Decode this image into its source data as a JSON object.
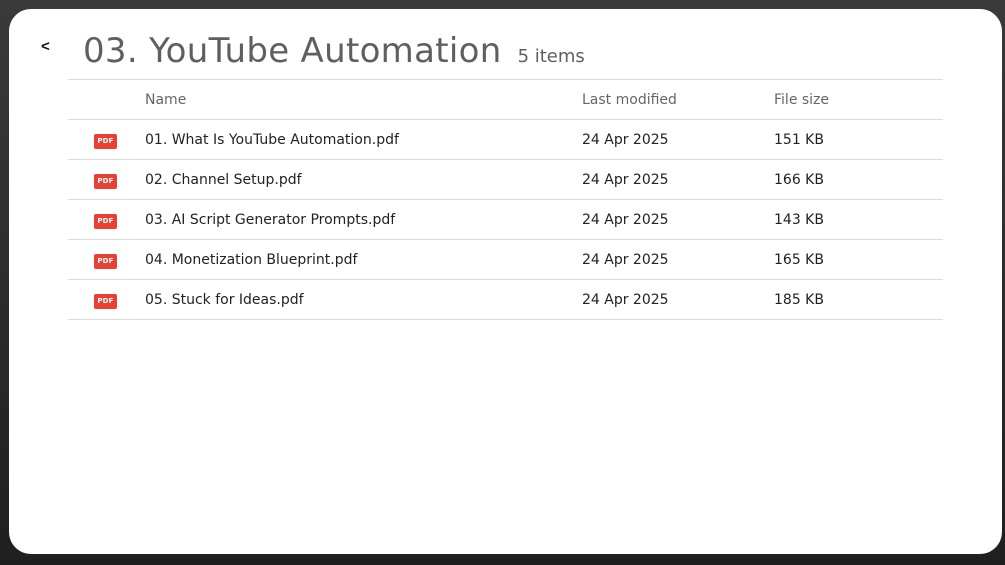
{
  "header": {
    "back_label": "<",
    "title": "03. YouTube Automation",
    "count": "5 items"
  },
  "columns": {
    "name": "Name",
    "modified": "Last modified",
    "size": "File size"
  },
  "file_icon_label": "PDF",
  "files": [
    {
      "name": "01. What Is YouTube Automation.pdf",
      "modified": "24 Apr 2025",
      "size": "151 KB"
    },
    {
      "name": "02. Channel Setup.pdf",
      "modified": "24 Apr 2025",
      "size": "166 KB"
    },
    {
      "name": "03. AI Script Generator Prompts.pdf",
      "modified": "24 Apr 2025",
      "size": "143 KB"
    },
    {
      "name": "04. Monetization Blueprint.pdf",
      "modified": "24 Apr 2025",
      "size": "165 KB"
    },
    {
      "name": "05. Stuck for Ideas.pdf",
      "modified": "24 Apr 2025",
      "size": "185 KB"
    }
  ],
  "colors": {
    "pdf_badge": "#e84133",
    "title_text": "#5f5f5f",
    "divider": "#dcdcdc"
  }
}
